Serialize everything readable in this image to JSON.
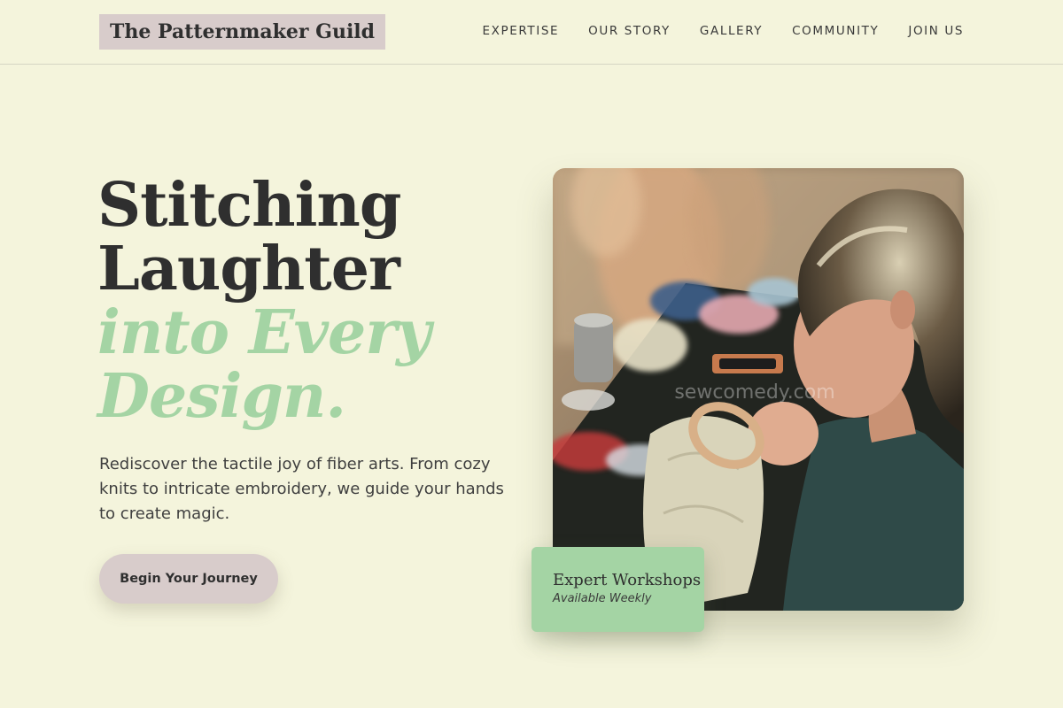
{
  "header": {
    "logo_text": "The Patternmaker Guild",
    "nav": [
      {
        "label": "EXPERTISE"
      },
      {
        "label": "OUR STORY"
      },
      {
        "label": "GALLERY"
      },
      {
        "label": "COMMUNITY"
      },
      {
        "label": "JOIN US"
      }
    ]
  },
  "hero": {
    "title_line1": "Stitching",
    "title_line2": "Laughter",
    "title_line3": "into Every",
    "title_line4": "Design.",
    "description": "Rediscover the tactile joy of fiber arts. From cozy knits to intricate embroidery, we guide your hands to create magic.",
    "cta_label": "Begin Your Journey"
  },
  "photo": {
    "watermark": "sewcomedy.com"
  },
  "badge": {
    "title": "Expert Workshops",
    "subtitle": "Available Weekly"
  },
  "colors": {
    "background": "#f4f4dc",
    "accent_green": "#a4d4a4",
    "accent_mauve": "#d8cccb",
    "text_dark": "#2f2f2f"
  }
}
